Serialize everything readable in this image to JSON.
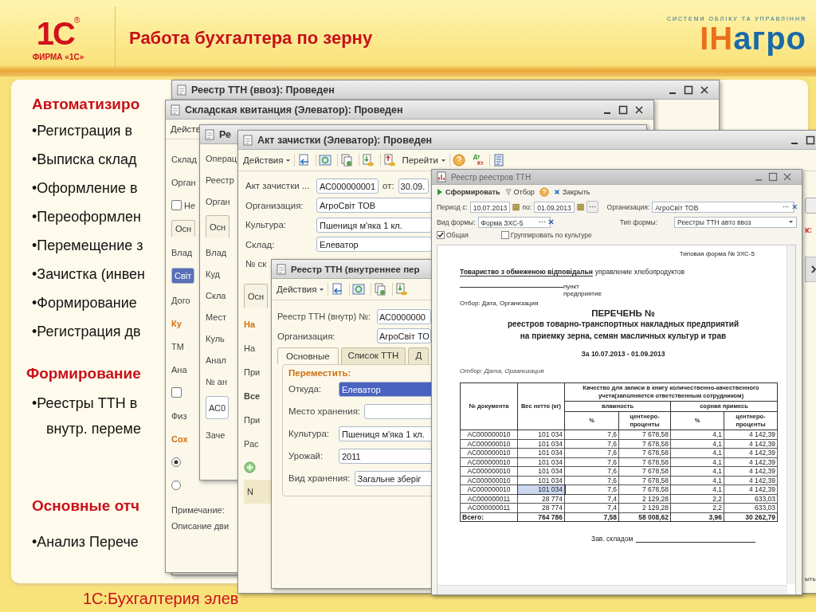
{
  "header": {
    "logo": {
      "mark": "1С",
      "registered": "®",
      "caption": "ФИРМА «1С»"
    },
    "title": "Работа бухгалтера по зерну",
    "partner_logo": {
      "tagline": "СИСТЕМИ ОБЛІКУ ТА УПРАВЛІННЯ",
      "name_first": "ІН",
      "name_rest": "агро"
    }
  },
  "slide": {
    "sections": [
      {
        "heading": "Автоматизиро",
        "lines": [
          {
            "kind": "bullet",
            "text": "•Регистрация в"
          },
          {
            "kind": "bullet",
            "text": "•Выписка склад"
          },
          {
            "kind": "bullet",
            "text": "•Оформление в"
          },
          {
            "kind": "bullet",
            "text": "•Переоформлен"
          },
          {
            "kind": "bullet",
            "text": "•Перемещение з"
          },
          {
            "kind": "bullet",
            "text": "•Зачистка (инвен"
          },
          {
            "kind": "bullet",
            "text": "•Формирование"
          },
          {
            "kind": "bullet",
            "text": "•Регистрация дв"
          }
        ]
      },
      {
        "heading": "Формирование",
        "lines": [
          {
            "kind": "bullet",
            "text": "•Реестры ТТН в"
          },
          {
            "kind": "continuation",
            "text": "внутр. переме"
          }
        ]
      },
      {
        "heading": "Основные отч",
        "lines": [
          {
            "kind": "bullet",
            "text": "•Анализ Перече"
          }
        ]
      }
    ]
  },
  "footer": {
    "text": "1С:Бухгалтерия элев"
  },
  "registry_import_window": {
    "title": "Реестр ТТН (ввоз): Проведен"
  },
  "warehouse_receipt_window": {
    "title": "Складская квитанция (Элеватор): Проведен",
    "toolbar": "Действ",
    "items": [
      {
        "kind": "label",
        "text": "Склад"
      },
      {
        "kind": "label",
        "text": "Орган"
      },
      {
        "kind": "checkbox",
        "text": "Не",
        "checked": false
      },
      {
        "kind": "tab",
        "text": "Осн"
      },
      {
        "kind": "label",
        "text": "Влад"
      },
      {
        "kind": "selected_field",
        "text": "Світ"
      },
      {
        "kind": "label",
        "text": "Дого"
      },
      {
        "kind": "group",
        "text": "Ку"
      },
      {
        "kind": "label",
        "text": "ТМ"
      },
      {
        "kind": "label",
        "text": "Ана"
      },
      {
        "kind": "checkbox",
        "checked": false
      },
      {
        "kind": "label",
        "text": "Физ"
      },
      {
        "kind": "group",
        "text": "Сох"
      },
      {
        "kind": "radio",
        "selected": true
      },
      {
        "kind": "radio",
        "selected": false
      }
    ],
    "notes": [
      "Примечание:",
      "Описание дви"
    ]
  },
  "registry_window": {
    "title": "Ре",
    "items": [
      {
        "kind": "label",
        "text": "Операц"
      },
      {
        "kind": "label",
        "text": "Реестр"
      },
      {
        "kind": "label",
        "text": "Орган"
      },
      {
        "kind": "tab",
        "text": "Осн"
      },
      {
        "kind": "label",
        "text": "Влад"
      },
      {
        "kind": "label",
        "text": "Куд"
      },
      {
        "kind": "label",
        "text": "Скла"
      },
      {
        "kind": "label",
        "text": "Мест"
      },
      {
        "kind": "label",
        "text": "Куль"
      },
      {
        "kind": "label",
        "text": "Анал"
      },
      {
        "kind": "label",
        "text": "№ ан"
      },
      {
        "kind": "field",
        "text": "АС0"
      },
      {
        "kind": "label",
        "text": "Заче"
      }
    ]
  },
  "cleaning_act_window": {
    "title": "Акт зачистки (Элеватор): Проведен",
    "toolbar": {
      "actions": "Действия",
      "goto": "Перейти",
      "debit": "Дт",
      "credit": "Кт"
    },
    "form": [
      {
        "label": "Акт зачистки ...",
        "value": "АС000000001",
        "date_label": "от:",
        "date": "30.09."
      },
      {
        "label": "Организация:",
        "value": "АгроСвіт ТОВ"
      },
      {
        "label": "Культура:",
        "value": "Пшениця м'яка 1 кл."
      },
      {
        "label": "Склад:",
        "value": "Елеватор"
      },
      {
        "label": "№ ск"
      }
    ],
    "items": [
      {
        "kind": "tab",
        "text": "Осн"
      },
      {
        "kind": "group",
        "text": "На"
      },
      {
        "kind": "label",
        "text": "На"
      },
      {
        "kind": "label",
        "text": "При"
      },
      {
        "kind": "bold",
        "text": "Все"
      },
      {
        "kind": "label",
        "text": "При"
      },
      {
        "kind": "label",
        "text": "Рас"
      },
      {
        "kind": "add_button"
      },
      {
        "kind": "grid_header",
        "text": "N"
      }
    ],
    "edge": {
      "warning": "к:",
      "caption": "ыть"
    }
  },
  "internal_registry_window": {
    "title": "Реестр ТТН (внутреннее пер",
    "toolbar": {
      "actions": "Действия"
    },
    "number": {
      "label": "Реестр ТТН (внутр) №:",
      "value": "АС0000000"
    },
    "organization": {
      "label": "Организация:",
      "value": "АгроСвіт ТО"
    },
    "tabs": [
      {
        "label": "Основные",
        "selected": true
      },
      {
        "label": "Список ТТН",
        "selected": false
      },
      {
        "label": "Д",
        "selected": false
      }
    ],
    "group": "Переместить:",
    "fields": [
      {
        "label": "Откуда:",
        "value": "Елеватор",
        "selected": true
      },
      {
        "label": "Место хранения:",
        "selected": false
      },
      {
        "label": "Культура:",
        "value": "Пшениця м'яка 1 кл.",
        "selected": false
      },
      {
        "label": "Урожай:",
        "value": "2011",
        "selected": false
      },
      {
        "label": "Вид хранения:",
        "value": "Загальне зберіг",
        "selected": false
      }
    ]
  },
  "registry_of_registries_window": {
    "title": "Реестр реестров ТТН",
    "toolbar": {
      "generate": "Сформировать",
      "filter": "Отбор",
      "close": "Закрыть"
    },
    "params": {
      "from_label": "Период с:",
      "from": "10.07.2013",
      "to_label": "по:",
      "to": "01.09.2013",
      "org_label": "Организация:",
      "org": "АгроСвіт ТОВ",
      "form_label": "Вид формы:",
      "form": "Форма ЗХС-5",
      "type_label": "Тип формы:",
      "type": "Реестры ТТН авто ввоз"
    },
    "options": [
      {
        "label": "Общая",
        "checked": true
      },
      {
        "label": "Группировать по культуре",
        "checked": false
      }
    ],
    "report": {
      "form_no": "Типовая форма № ЗХС-5",
      "org_name": "Товариство з обмеженою відповідальн",
      "org_suffix": "управление хлебопродуктов",
      "point": "пункт",
      "enterprise": "предприятие",
      "filter_1": "Отбор: Дата, Организация",
      "title": "ПЕРЕЧЕНЬ №",
      "subtitle": [
        "реестров товарно-транспортных накладных предприятий",
        "на приемку зерна, семян масличных культур и трав"
      ],
      "period": "За 10.07.2013 - 01.09.2013",
      "filter_2": "Отбор: Дата, Организация",
      "table": {
        "doc": "№ документа",
        "weight": "Вес нетто (кг)",
        "quality": "Качество для записи в книгу количественно-качественного учета(заполняется ответственным сотрудником)",
        "moisture": "влажность",
        "weed": "сорная примесь",
        "sub_columns": [
          "%",
          "центнеро-проценты",
          "%",
          "центнеро-проценты"
        ],
        "rows": [
          {
            "cells": [
              "АС000000010",
              "101 034",
              "7,6",
              "7 678,58",
              "4,1",
              "4 142,39"
            ],
            "selected": false
          },
          {
            "cells": [
              "АС000000010",
              "101 034",
              "7,6",
              "7 678,58",
              "4,1",
              "4 142,39"
            ],
            "selected": false
          },
          {
            "cells": [
              "АС000000010",
              "101 034",
              "7,6",
              "7 678,58",
              "4,1",
              "4 142,39"
            ],
            "selected": false
          },
          {
            "cells": [
              "АС000000010",
              "101 034",
              "7,6",
              "7 678,58",
              "4,1",
              "4 142,39"
            ],
            "selected": false
          },
          {
            "cells": [
              "АС000000010",
              "101 034",
              "7,6",
              "7 678,58",
              "4,1",
              "4 142,39"
            ],
            "selected": false
          },
          {
            "cells": [
              "АС000000010",
              "101 034",
              "7,6",
              "7 678,58",
              "4,1",
              "4 142,39"
            ],
            "selected": false
          },
          {
            "cells": [
              "АС000000010",
              "101 034",
              "7,6",
              "7 678,58",
              "4,1",
              "4 142,39"
            ],
            "selected": true
          },
          {
            "cells": [
              "АС000000011",
              "28 774",
              "7,4",
              "2 129,28",
              "2,2",
              "633,03"
            ],
            "selected": false
          },
          {
            "cells": [
              "АС000000011",
              "28 774",
              "7,4",
              "2 129,28",
              "2,2",
              "633,03"
            ],
            "selected": false
          }
        ],
        "total": [
          "Всего:",
          "764 786",
          "7,58",
          "58 008,62",
          "3,96",
          "30 262,79"
        ]
      },
      "signature": "Зав. складом"
    }
  }
}
